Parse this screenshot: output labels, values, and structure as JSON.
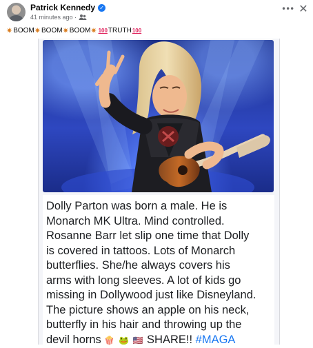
{
  "post": {
    "author": "Patrick Kennedy",
    "timestamp": "41 minutes ago ·",
    "caption": {
      "word1": "BOOM",
      "word2": "BOOM",
      "word3": "BOOM",
      "word4": "TRUTH",
      "hundred": "100"
    },
    "text_lines": [
      "Dolly Parton was born a male. He is",
      "Monarch MK Ultra. Mind controlled.",
      "Rosanne Barr let slip one time that Dolly",
      "is covered in tattoos.  Lots of Monarch",
      "butterflies. She/he always covers his",
      "arms with long sleeves.  A lot of kids go",
      "missing in Dollywood just like Disneyland.",
      "The picture shows an apple on his neck,",
      "butterfly in his hair and throwing up the",
      "devil horns"
    ],
    "share_text": "SHARE!!",
    "hashtag": "#MAGA"
  },
  "icons": {
    "verified": "verified-badge-icon",
    "audience": "friends-audience-icon",
    "more": "more-options-icon",
    "close": "close-icon",
    "caption_emoji": "boom-gear-icon",
    "popcorn": "popcorn-icon",
    "frog": "frog-icon",
    "flag": "us-flag-icon"
  },
  "colors": {
    "facebook_blue": "#1877f2",
    "hundred_red": "#e0245e"
  }
}
